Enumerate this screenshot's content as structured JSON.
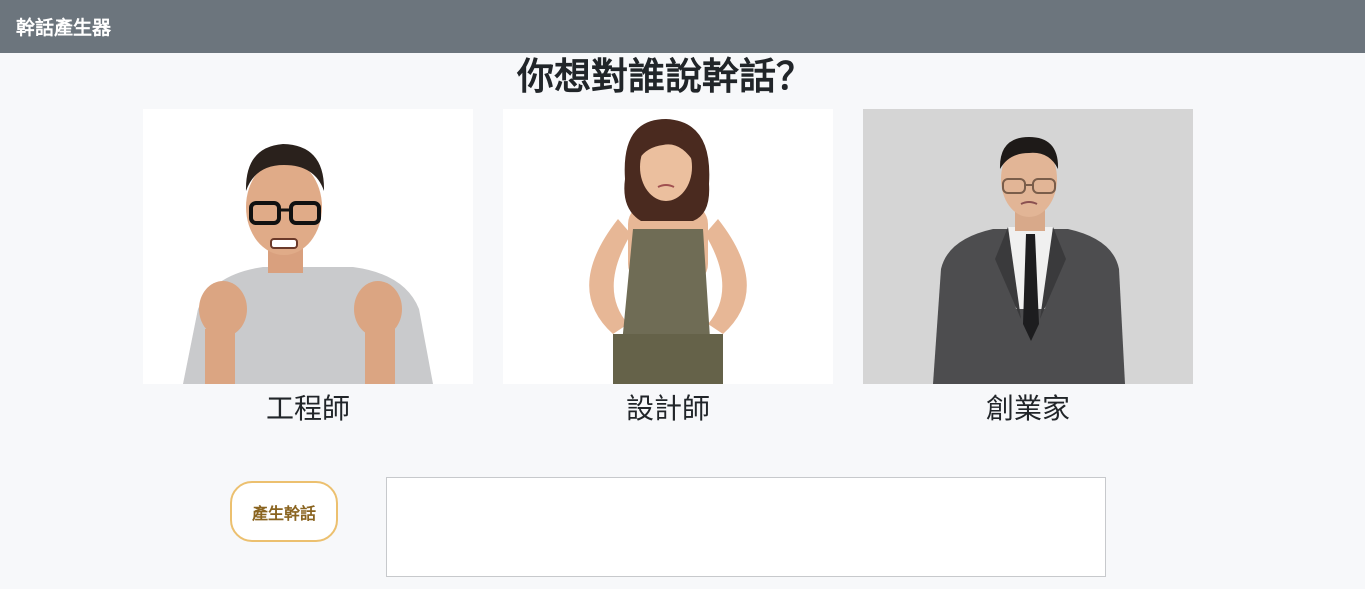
{
  "navbar": {
    "brand": "幹話產生器"
  },
  "main": {
    "title": "你想對誰說幹話？",
    "cards": [
      {
        "label": "工程師",
        "image": "angry-engineer-photo"
      },
      {
        "label": "設計師",
        "image": "annoyed-designer-photo"
      },
      {
        "label": "創業家",
        "image": "skeptical-entrepreneur-photo"
      }
    ]
  },
  "controls": {
    "generate_label": "產生幹話",
    "output_text": ""
  },
  "colors": {
    "navbar": "#6c757d",
    "button_border": "#ecc06f",
    "button_text": "#8a6420",
    "background": "#f7f8fa"
  }
}
